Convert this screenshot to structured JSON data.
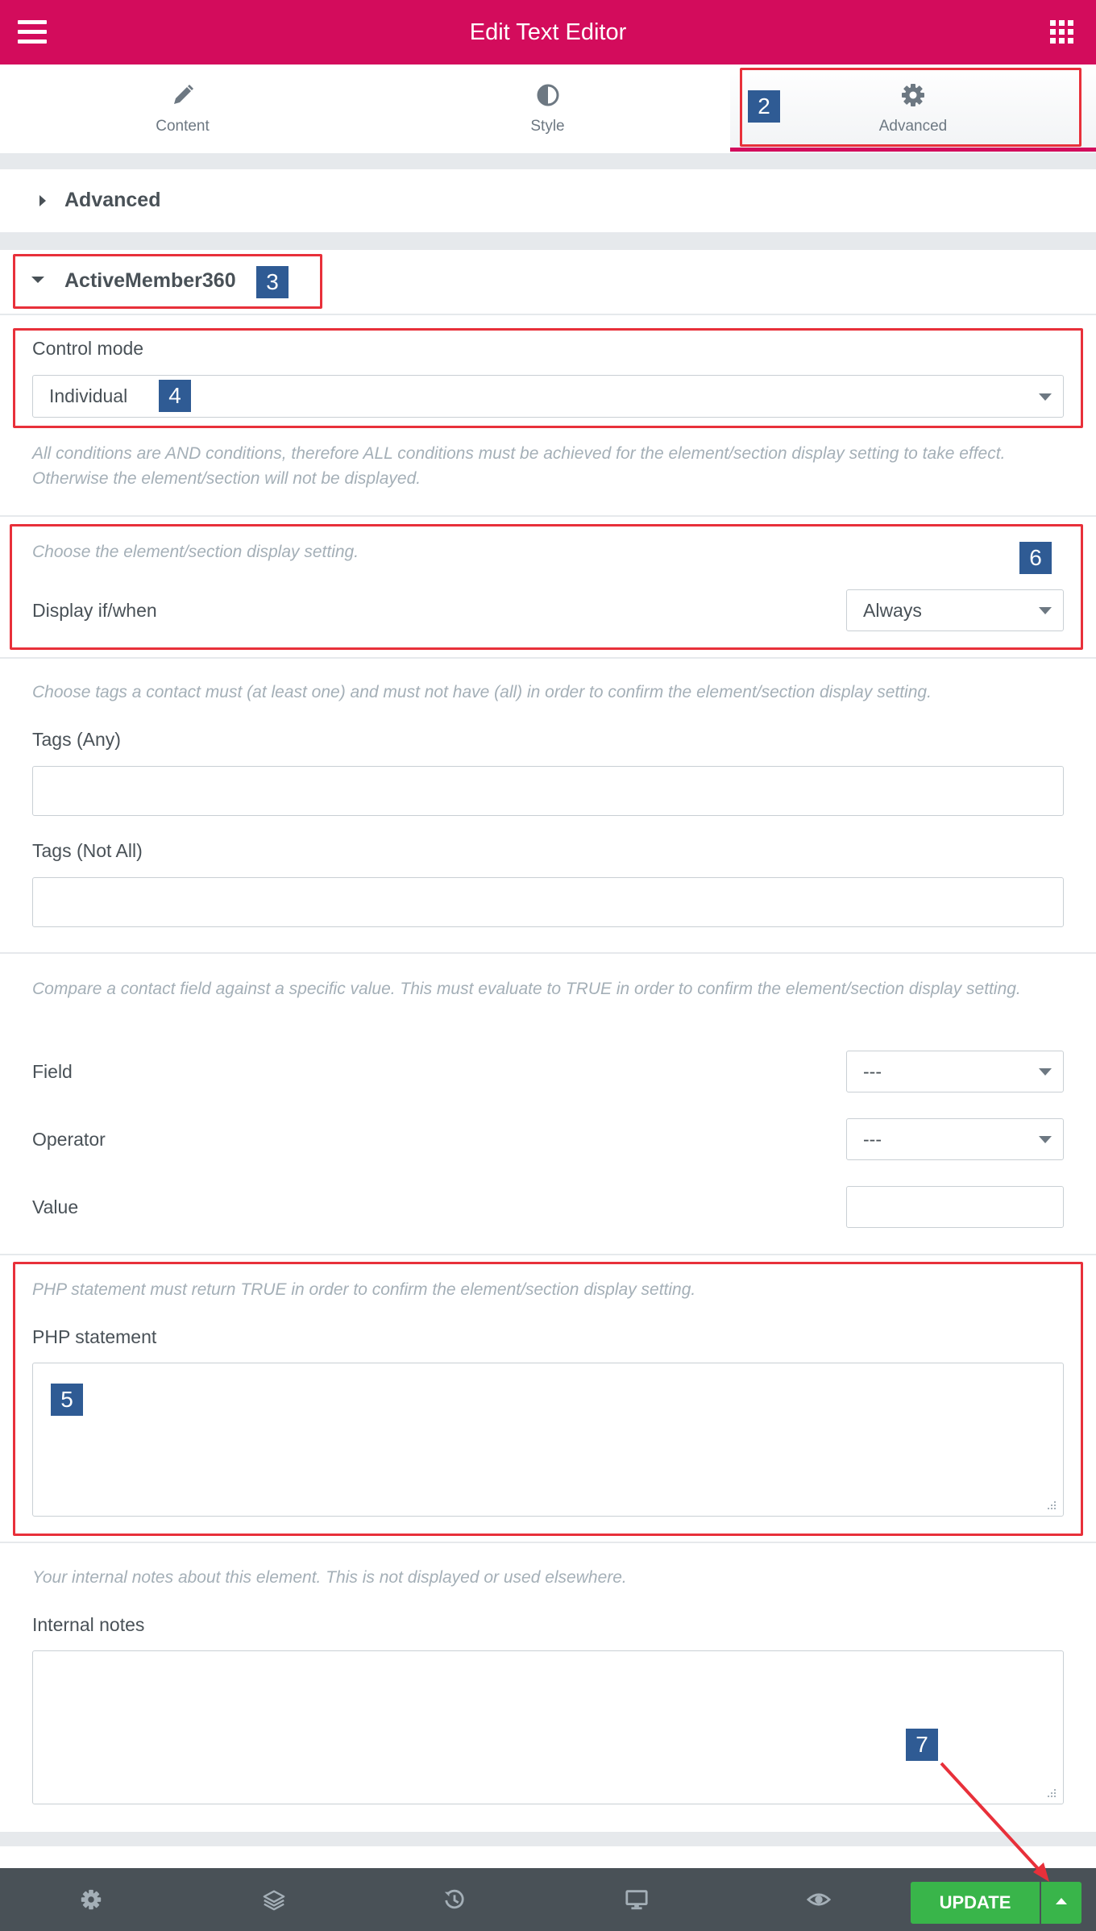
{
  "header": {
    "title": "Edit Text Editor",
    "menu_icon": "hamburger-menu-icon",
    "apps_icon": "grid-apps-icon",
    "color": "#d30c5c"
  },
  "tabs": [
    {
      "label": "Content",
      "icon": "pencil-icon"
    },
    {
      "label": "Style",
      "icon": "half-circle-contrast-icon"
    },
    {
      "label": "Advanced",
      "icon": "gear-icon",
      "active": true
    }
  ],
  "sections": {
    "advanced": {
      "title": "Advanced",
      "expanded": false
    },
    "activemember": {
      "title": "ActiveMember360",
      "expanded": true
    }
  },
  "control_mode": {
    "label": "Control mode",
    "value": "Individual",
    "description": "All conditions are AND conditions, therefore ALL conditions must be achieved for the element/section display setting to take effect. Otherwise the element/section will not be displayed."
  },
  "display": {
    "description": "Choose the element/section display setting.",
    "label": "Display if/when",
    "value": "Always"
  },
  "tags": {
    "description": "Choose tags a contact must (at least one) and must not have (all) in order to confirm the element/section display setting.",
    "any_label": "Tags (Any)",
    "any_value": "",
    "not_all_label": "Tags (Not All)",
    "not_all_value": ""
  },
  "field_compare": {
    "description": "Compare a contact field against a specific value. This must evaluate to TRUE in order to confirm the element/section display setting.",
    "field_label": "Field",
    "field_value": "---",
    "operator_label": "Operator",
    "operator_value": "---",
    "value_label": "Value",
    "value_value": ""
  },
  "php": {
    "description": "PHP statement must return TRUE in order to confirm the element/section display setting.",
    "label": "PHP statement",
    "value": ""
  },
  "notes": {
    "description": "Your internal notes about this element. This is not displayed or used elsewhere.",
    "label": "Internal notes",
    "value": ""
  },
  "annotations": {
    "badge_2": "2",
    "badge_3": "3",
    "badge_4": "4",
    "badge_5": "5",
    "badge_6": "6",
    "badge_7": "7",
    "box_color": "#e8303a",
    "badge_color": "#2f5b94"
  },
  "bottom_bar": {
    "icons": [
      "gear-icon",
      "layers-icon",
      "history-icon",
      "desktop-icon",
      "eye-icon"
    ],
    "update_label": "UPDATE",
    "update_color": "#39b54a"
  }
}
